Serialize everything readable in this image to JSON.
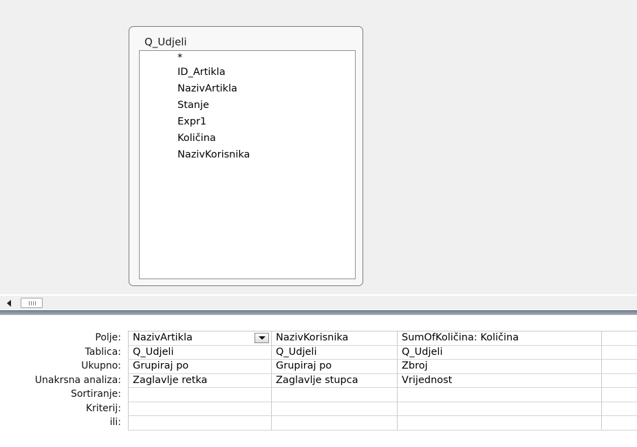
{
  "design": {
    "table": {
      "title": "Q_Udjeli",
      "fields": [
        "*",
        "ID_Artikla",
        "NazivArtikla",
        "Stanje",
        "Expr1",
        "Količina",
        "NazivKorisnika"
      ]
    }
  },
  "grid": {
    "row_labels": [
      "Polje:",
      "Tablica:",
      "Ukupno:",
      "Unakrsna analiza:",
      "Sortiranje:",
      "Kriterij:",
      "ili:"
    ],
    "columns": [
      {
        "polje": "NazivArtikla",
        "tablica": "Q_Udjeli",
        "ukupno": "Grupiraj po",
        "unakrsna": "Zaglavlje retka",
        "sortiranje": "",
        "kriterij": "",
        "ili": ""
      },
      {
        "polje": "NazivKorisnika",
        "tablica": "Q_Udjeli",
        "ukupno": "Grupiraj po",
        "unakrsna": "Zaglavlje stupca",
        "sortiranje": "",
        "kriterij": "",
        "ili": ""
      },
      {
        "polje": "SumOfKoličina: Količina",
        "tablica": "Q_Udjeli",
        "ukupno": "Zbroj",
        "unakrsna": "Vrijednost",
        "sortiranje": "",
        "kriterij": "",
        "ili": ""
      },
      {
        "polje": "",
        "tablica": "",
        "ukupno": "",
        "unakrsna": "",
        "sortiranje": "",
        "kriterij": "",
        "ili": ""
      }
    ]
  },
  "icons": {
    "scroll_left": "chevron-left-icon",
    "dropdown": "chevron-down-icon"
  }
}
